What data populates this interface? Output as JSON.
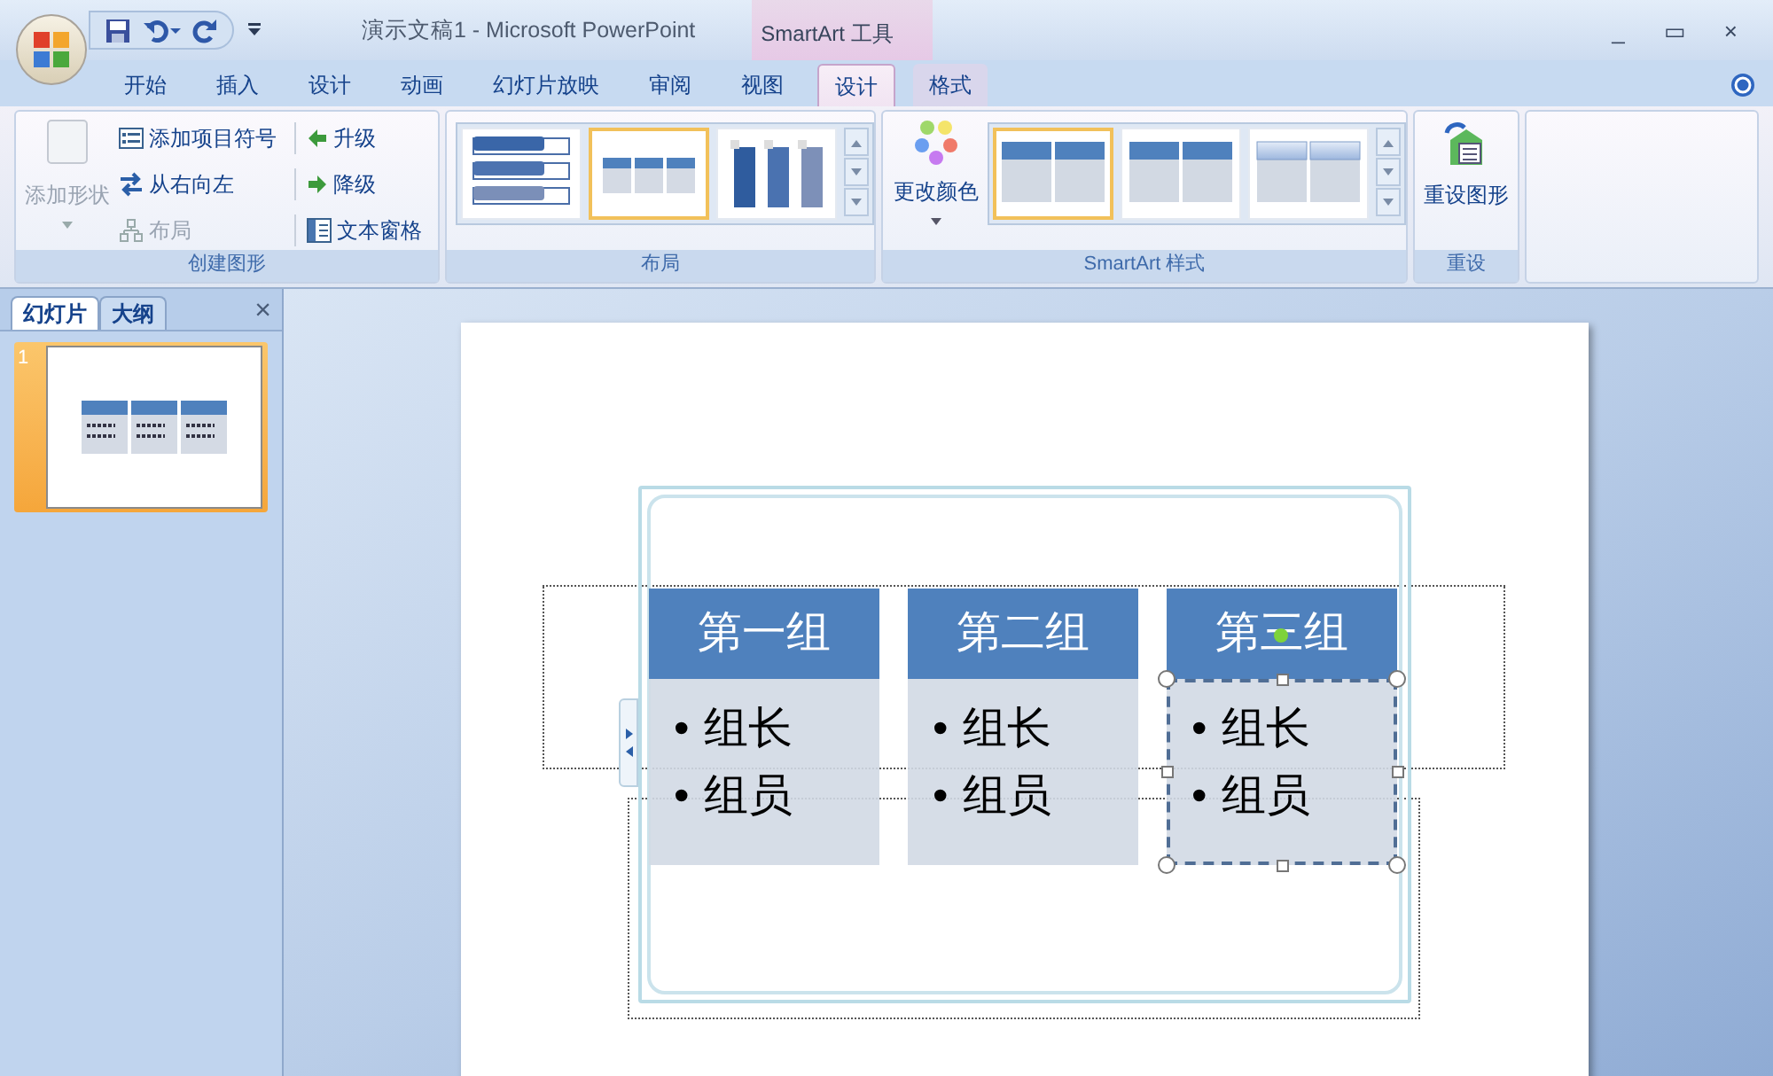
{
  "title_bar": {
    "title": "演示文稿1 - Microsoft PowerPoint",
    "context_group": "SmartArt 工具",
    "window_controls": [
      "_",
      "▭",
      "×"
    ]
  },
  "tabs": [
    {
      "label": "开始",
      "selected": false,
      "context": false
    },
    {
      "label": "插入",
      "selected": false,
      "context": false
    },
    {
      "label": "设计",
      "selected": false,
      "context": false
    },
    {
      "label": "动画",
      "selected": false,
      "context": false
    },
    {
      "label": "幻灯片放映",
      "selected": false,
      "context": false
    },
    {
      "label": "审阅",
      "selected": false,
      "context": false
    },
    {
      "label": "视图",
      "selected": false,
      "context": false
    },
    {
      "label": "设计",
      "selected": true,
      "context": true
    },
    {
      "label": "格式",
      "selected": false,
      "context": true
    }
  ],
  "ribbon": {
    "create_group": {
      "label": "创建图形",
      "add_shape": {
        "label": "添加形状",
        "disabled": true
      },
      "commands": [
        {
          "label": "添加项目符号",
          "kind": "bullet",
          "disabled": false
        },
        {
          "label": "从右向左",
          "kind": "rtl",
          "disabled": false
        },
        {
          "label": "布局",
          "kind": "layout",
          "disabled": true
        },
        {
          "label": "升级",
          "kind": "promote",
          "disabled": false
        },
        {
          "label": "降级",
          "kind": "demote",
          "disabled": false
        },
        {
          "label": "文本窗格",
          "kind": "pane",
          "disabled": false
        }
      ]
    },
    "layout_group": {
      "label": "布局",
      "layouts": [
        {
          "kind": "stacked",
          "selected": false
        },
        {
          "kind": "columns",
          "selected": true
        },
        {
          "kind": "vertical",
          "selected": false
        }
      ]
    },
    "style_group": {
      "label": "SmartArt 样式",
      "change_colors": "更改颜色",
      "styles": [
        {
          "kind": "flat",
          "selected": true
        },
        {
          "kind": "flat",
          "selected": false
        },
        {
          "kind": "gradient",
          "selected": false
        }
      ]
    },
    "reset_group": {
      "label": "重设",
      "reset_button": "重设图形"
    }
  },
  "slides_panel": {
    "tabs": [
      {
        "label": "幻灯片",
        "selected": true
      },
      {
        "label": "大纲",
        "selected": false
      }
    ],
    "close": "×",
    "slides": [
      {
        "number": "1",
        "selected": true
      }
    ]
  },
  "slide": {
    "smartart": [
      {
        "title": "第一组",
        "items": [
          {
            "bullet": "•",
            "text": "组长"
          },
          {
            "bullet": "•",
            "text": "组员"
          }
        ],
        "selected": false
      },
      {
        "title": "第二组",
        "items": [
          {
            "bullet": "•",
            "text": "组长"
          },
          {
            "bullet": "•",
            "text": "组员"
          }
        ],
        "selected": false
      },
      {
        "title": "第三组",
        "items": [
          {
            "bullet": "•",
            "text": "组长"
          },
          {
            "bullet": "•",
            "text": "组员"
          }
        ],
        "selected": true
      }
    ]
  }
}
